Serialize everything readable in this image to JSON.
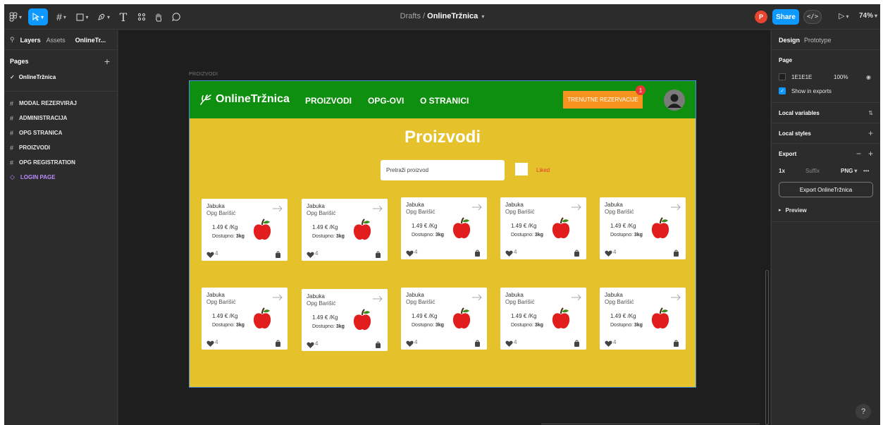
{
  "toolbar": {
    "drafts": "Drafts",
    "separator": "/",
    "file_name": "OnlineTržnica",
    "user_initial": "P",
    "share_label": "Share",
    "code_label": "</>",
    "zoom": "74%"
  },
  "left_panel": {
    "tabs": {
      "layers": "Layers",
      "assets": "Assets",
      "file": "OnlineTr..."
    },
    "pages_title": "Pages",
    "current_page": "OnlineTržnica",
    "layers": [
      {
        "label": "MODAL REZERVIRAJ",
        "icon": "frame-icon"
      },
      {
        "label": "ADMINISTRACIJA",
        "icon": "frame-icon"
      },
      {
        "label": "OPG STRANICA",
        "icon": "frame-icon"
      },
      {
        "label": "PROIZVODI",
        "icon": "frame-icon"
      },
      {
        "label": "OPG REGISTRATION",
        "icon": "frame-icon"
      },
      {
        "label": "LOGIN PAGE",
        "icon": "component-icon"
      }
    ]
  },
  "canvas": {
    "frame_label": "PROIZVODI",
    "nav": {
      "logo": "OnlineTržnica",
      "links": [
        "PROIZVODI",
        "OPG-OVI",
        "O STRANICI"
      ],
      "reservations": "TRENUTNE REZERVACIJE",
      "reservations_badge": "1"
    },
    "heading": "Proizvodi",
    "search_placeholder": "Pretraži proizvod",
    "liked_label": "Liked",
    "colors": {
      "nav": "#0f8f0f",
      "background": "#e5c22b",
      "button": "#f7931e",
      "badge": "#e53935"
    },
    "products": [
      {
        "name": "Jabuka",
        "seller": "Opg Barišić",
        "price": "1.49 € /Kg",
        "stock_label": "Dostupno:",
        "stock_value": "3kg",
        "likes": "4"
      },
      {
        "name": "Jabuka",
        "seller": "Opg Barišić",
        "price": "1.49 € /Kg",
        "stock_label": "Dostupno:",
        "stock_value": "3kg",
        "likes": "4"
      },
      {
        "name": "Jabuka",
        "seller": "Opg Barišić",
        "price": "1.49 € /Kg",
        "stock_label": "Dostupno:",
        "stock_value": "3kg",
        "likes": "4"
      },
      {
        "name": "Jabuka",
        "seller": "Opg Barišić",
        "price": "1.49 € /Kg",
        "stock_label": "Dostupno:",
        "stock_value": "3kg",
        "likes": "4"
      },
      {
        "name": "Jabuka",
        "seller": "Opg Barišić",
        "price": "1.49 € /Kg",
        "stock_label": "Dostupno:",
        "stock_value": "3kg",
        "likes": "4"
      },
      {
        "name": "Jabuka",
        "seller": "Opg Barišić",
        "price": "1.49 € /Kg",
        "stock_label": "Dostupno:",
        "stock_value": "3kg",
        "likes": "4"
      },
      {
        "name": "Jabuka",
        "seller": "Opg Barišić",
        "price": "1.49 € /Kg",
        "stock_label": "Dostupno:",
        "stock_value": "3kg",
        "likes": "4"
      },
      {
        "name": "Jabuka",
        "seller": "Opg Barišić",
        "price": "1.49 € /Kg",
        "stock_label": "Dostupno:",
        "stock_value": "3kg",
        "likes": "4"
      },
      {
        "name": "Jabuka",
        "seller": "Opg Barišić",
        "price": "1.49 € /Kg",
        "stock_label": "Dostupno:",
        "stock_value": "3kg",
        "likes": "4"
      },
      {
        "name": "Jabuka",
        "seller": "Opg Barišić",
        "price": "1.49 € /Kg",
        "stock_label": "Dostupno:",
        "stock_value": "3kg",
        "likes": "4"
      }
    ]
  },
  "right_panel": {
    "tabs": {
      "design": "Design",
      "prototype": "Prototype"
    },
    "page_title": "Page",
    "page_color": "1E1E1E",
    "page_opacity": "100%",
    "show_in_exports": "Show in exports",
    "local_variables": "Local variables",
    "local_styles": "Local styles",
    "export_title": "Export",
    "export_scale": "1x",
    "export_suffix": "Suffix",
    "export_format": "PNG",
    "export_button": "Export OnlineTržnica",
    "preview": "Preview"
  },
  "help": "?"
}
